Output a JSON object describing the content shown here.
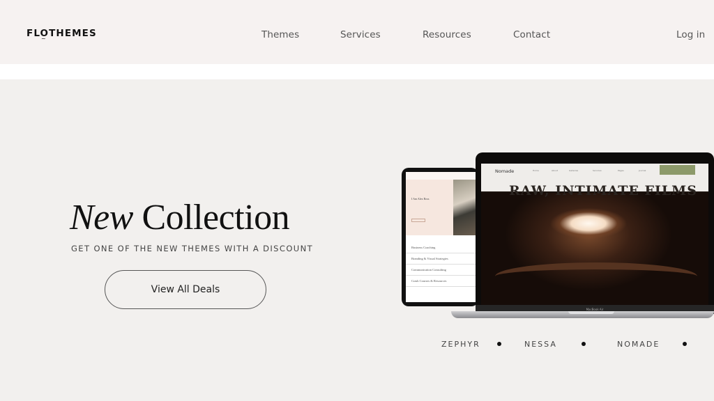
{
  "header": {
    "logo": "FLOTHEMES",
    "nav": [
      {
        "label": "Themes"
      },
      {
        "label": "Services"
      },
      {
        "label": "Resources"
      },
      {
        "label": "Contact"
      }
    ],
    "login_label": "Log in"
  },
  "hero": {
    "title_italic": "New",
    "title_rest": " Collection",
    "subtitle": "GET ONE OF THE NEW THEMES WITH A DISCOUNT",
    "cta_label": "View All Deals"
  },
  "mockup": {
    "tablet": {
      "hero_text": "I Am Alex Ross",
      "items": [
        "Business Coaching",
        "Branding & Visual Strategies",
        "Communication Consulting",
        "Crash Courses & Resources"
      ]
    },
    "laptop": {
      "site_logo": "Nomade",
      "nav_items": [
        "Home",
        "About",
        "Galleries",
        "Services",
        "Pages",
        "Journal"
      ],
      "headline": "RAW, INTIMATE FILMS",
      "device_label": "MacBook Air"
    }
  },
  "collections": [
    {
      "label": "ZEPHYR"
    },
    {
      "label": "NESSA"
    },
    {
      "label": "NOMADE"
    }
  ],
  "colors": {
    "header_bg": "#f6f2f1",
    "hero_bg": "#f2f0ee",
    "cta_green": "#8d9a6a"
  }
}
